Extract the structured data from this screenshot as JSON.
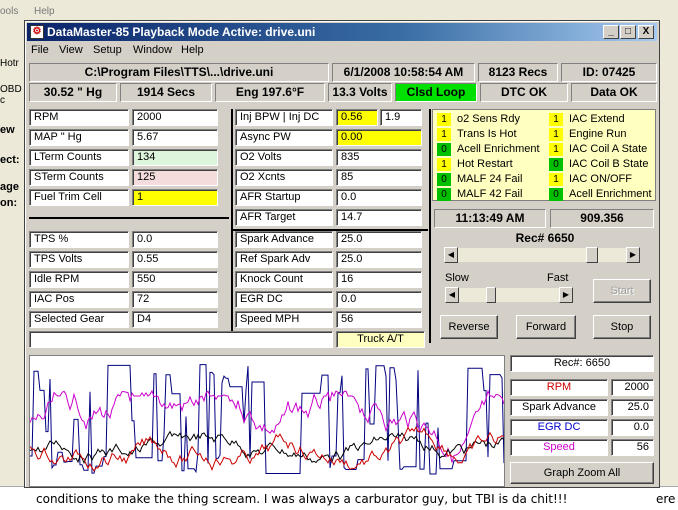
{
  "background": {
    "menu": [
      "ools",
      "Help"
    ],
    "left_fragments": [
      "Hotr",
      "OBD c",
      "ew",
      "ect:",
      "age",
      "on:"
    ],
    "bottom_text": "conditions to make the thing scream. I was always a carburator guy, but TBI is da chit!!!",
    "bottom_text_right": "ere"
  },
  "window": {
    "title": "DataMaster-85  Playback Mode Active: drive.uni",
    "app_icon": "datamaster-icon",
    "controls": {
      "minimize": "_",
      "maximize": "□",
      "close": "X"
    },
    "menu": [
      "File",
      "View",
      "Setup",
      "Window",
      "Help"
    ]
  },
  "status": {
    "path": "C:\\Program Files\\TTS\\...\\drive.uni",
    "date_time": "6/1/2008  10:58:54 AM",
    "records": "8123 Recs",
    "id": "ID:  07425",
    "baro": "30.52  \" Hg",
    "secs": "1914 Secs",
    "eng_temp": "Eng  197.6°F",
    "volts": "13.3 Volts",
    "loop": "Clsd Loop",
    "dtc": "DTC OK",
    "data": "Data OK"
  },
  "params_left": [
    {
      "label": "RPM",
      "value": "2000",
      "bg": "#ffffff"
    },
    {
      "label": "MAP  \" Hg",
      "value": "5.67",
      "bg": "#ffffff"
    },
    {
      "label": "LTerm Counts",
      "value": "134",
      "bg": "#dcf5dc"
    },
    {
      "label": "STerm Counts",
      "value": "125",
      "bg": "#f5dcdc"
    },
    {
      "label": "Fuel Trim Cell",
      "value": "1",
      "bg": "#ffff00"
    }
  ],
  "params_left2": [
    {
      "label": "TPS %",
      "value": "0.0"
    },
    {
      "label": "TPS Volts",
      "value": "0.55"
    },
    {
      "label": "Idle RPM",
      "value": "550"
    },
    {
      "label": "IAC Pos",
      "value": "72"
    },
    {
      "label": "Selected Gear",
      "value": "D4"
    }
  ],
  "params_mid": [
    {
      "label": "Inj BPW  |  Inj DC",
      "value": "0.56",
      "value2": "1.9"
    },
    {
      "label": "Async PW",
      "value": "0.00"
    },
    {
      "label": "O2 Volts",
      "value": "835"
    },
    {
      "label": "O2 Xcnts",
      "value": "85"
    },
    {
      "label": "AFR Startup",
      "value": "0.0"
    },
    {
      "label": "AFR Target",
      "value": "14.7"
    }
  ],
  "params_mid2": [
    {
      "label": "Spark Advance",
      "value": "25.0"
    },
    {
      "label": "Ref Spark Adv",
      "value": "25.0"
    },
    {
      "label": "Knock Count",
      "value": "16"
    },
    {
      "label": "EGR DC",
      "value": "0.0"
    },
    {
      "label": "Speed MPH",
      "value": "56"
    }
  ],
  "truck": "Truck A/T",
  "indicators_left": [
    {
      "value": "1",
      "color": "y",
      "label": "o2 Sens Rdy"
    },
    {
      "value": "1",
      "color": "y",
      "label": "Trans Is Hot"
    },
    {
      "value": "0",
      "color": "g",
      "label": "Acell Enrichment"
    },
    {
      "value": "1",
      "color": "y",
      "label": "Hot Restart"
    },
    {
      "value": "0",
      "color": "g",
      "label": "MALF 24 Fail"
    },
    {
      "value": "0",
      "color": "g",
      "label": "MALF 42 Fail"
    }
  ],
  "indicators_right": [
    {
      "value": "1",
      "color": "y",
      "label": "IAC Extend"
    },
    {
      "value": "1",
      "color": "y",
      "label": "Engine Run"
    },
    {
      "value": "1",
      "color": "y",
      "label": "IAC Coil A State"
    },
    {
      "value": "0",
      "color": "g",
      "label": "IAC Coil B State"
    },
    {
      "value": "1",
      "color": "y",
      "label": "IAC ON/OFF"
    },
    {
      "value": "0",
      "color": "g",
      "label": "Acell Enrichment"
    }
  ],
  "playback": {
    "time": "11:13:49 AM",
    "seconds": "909.356",
    "record": "Rec# 6650",
    "record_position": 0.82,
    "speed_slow": "Slow",
    "speed_fast": "Fast",
    "speed_position": 0.3,
    "start": "Start",
    "reverse": "Reverse",
    "forward": "Forward",
    "stop": "Stop"
  },
  "legend": {
    "record": "Rec#:  6650",
    "items": [
      {
        "name": "RPM",
        "value": "2000",
        "color": "#cc0000"
      },
      {
        "name": "Spark Advance",
        "value": "25.0",
        "color": "#000000"
      },
      {
        "name": "EGR DC",
        "value": "0.0",
        "color": "#0000cc"
      },
      {
        "name": "Speed",
        "value": "56",
        "color": "#cc00cc"
      }
    ],
    "zoom": "Graph Zoom All"
  },
  "graph_colors": {
    "navy": "#000080",
    "black": "#000000",
    "magenta": "#cc00cc",
    "red": "#cc0000"
  }
}
